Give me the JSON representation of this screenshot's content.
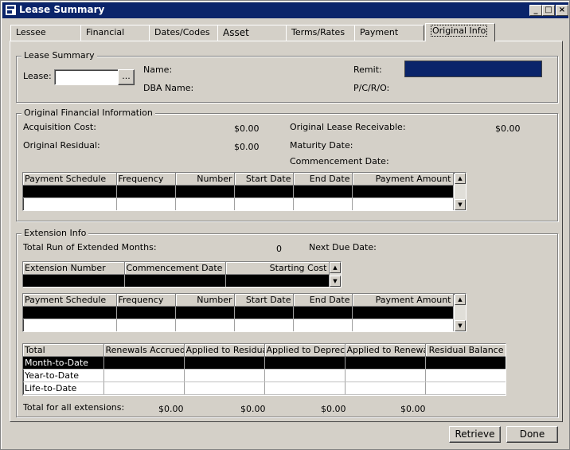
{
  "window": {
    "title": "Lease Summary"
  },
  "tabs": [
    {
      "label": "Lessee"
    },
    {
      "label": "Financial"
    },
    {
      "label": "Dates/Codes"
    },
    {
      "label": "Asset"
    },
    {
      "label": "Terms/Rates"
    },
    {
      "label": "Payment"
    },
    {
      "label": "Original Info"
    }
  ],
  "lease_summary": {
    "legend": "Lease Summary",
    "lease_label": "Lease:",
    "lease_value": "",
    "browse_label": "...",
    "name_label": "Name:",
    "dba_label": "DBA Name:",
    "remit_label": "Remit:",
    "pcro_label": "P/C/R/O:"
  },
  "original_financial": {
    "legend": "Original Financial Information",
    "acq_label": "Acquisition Cost:",
    "acq_value": "$0.00",
    "residual_label": "Original Residual:",
    "residual_value": "$0.00",
    "olr_label": "Original Lease Receivable:",
    "olr_value": "$0.00",
    "maturity_label": "Maturity Date:",
    "commencement_label": "Commencement Date:",
    "schedule_columns": [
      "Payment Schedule",
      "Frequency",
      "Number",
      "Start Date",
      "End Date",
      "Payment Amount"
    ]
  },
  "extension": {
    "legend": "Extension Info",
    "run_label": "Total Run of Extended Months:",
    "run_value": "0",
    "next_due_label": "Next Due Date:",
    "ext_columns": [
      "Extension Number",
      "Commencement Date",
      "Starting Cost"
    ],
    "schedule_columns": [
      "Payment Schedule",
      "Frequency",
      "Number",
      "Start Date",
      "End Date",
      "Payment Amount"
    ],
    "totals_columns": [
      "Total",
      "Renewals Accrued",
      "Applied to Residual",
      "Applied to Deprec.",
      "Applied to Renewal",
      "Residual Balance"
    ],
    "totals_rows": [
      "Month-to-Date",
      "Year-to-Date",
      "Life-to-Date"
    ],
    "all_ext_label": "Total for all extensions:",
    "all_ext_values": [
      "$0.00",
      "$0.00",
      "$0.00",
      "$0.00"
    ]
  },
  "buttons": {
    "retrieve": "Retrieve",
    "done": "Done"
  },
  "colors": {
    "titlebar": "#0a246a",
    "face": "#d4d0c8",
    "remit_field": "#0a246a"
  }
}
